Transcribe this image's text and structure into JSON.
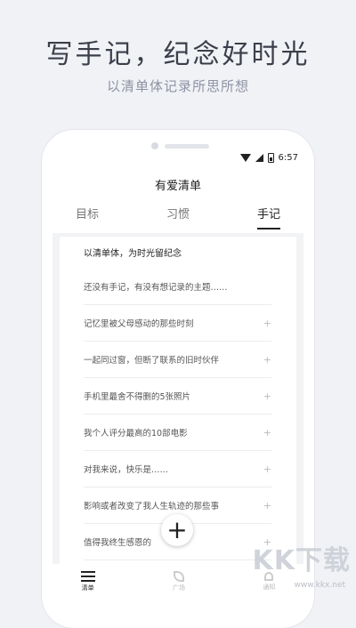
{
  "headline": "写手记，纪念好时光",
  "subline": "以清单体记录所思所想",
  "status": {
    "time": "6:57"
  },
  "app": {
    "title": "有爱清单"
  },
  "tabs": [
    {
      "label": "目标"
    },
    {
      "label": "习惯"
    },
    {
      "label": "手记",
      "active": true
    }
  ],
  "card": {
    "title": "以清单体，为时光留纪念",
    "items": [
      {
        "text": "还没有手记，有没有想记录的主题……",
        "plus": ""
      },
      {
        "text": "记忆里被父母感动的那些时刻",
        "plus": "+"
      },
      {
        "text": "一起同过窗，但断了联系的旧时伙伴",
        "plus": "+"
      },
      {
        "text": "手机里最舍不得删的5张照片",
        "plus": "+"
      },
      {
        "text": "我个人评分最高的10部电影",
        "plus": "+"
      },
      {
        "text": "对我来说，快乐是……",
        "plus": "+"
      },
      {
        "text": "影响或者改变了我人生轨迹的那些事",
        "plus": "+"
      },
      {
        "text": "值得我终生感恩的",
        "plus": "+"
      }
    ]
  },
  "fab": {
    "label": "+"
  },
  "bottom_nav": [
    {
      "label": "清单",
      "icon": "list-icon",
      "active": true
    },
    {
      "label": "广场",
      "icon": "leaf-icon"
    },
    {
      "label": "通知",
      "icon": "bell-icon"
    }
  ],
  "watermark": {
    "text": "KK下载",
    "url": "www.kkx.net"
  }
}
